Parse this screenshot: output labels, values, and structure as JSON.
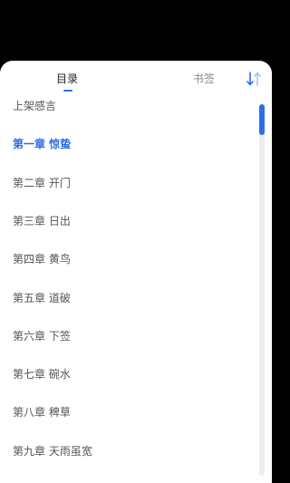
{
  "tabs": {
    "toc_label": "目录",
    "bookmarks_label": "书签"
  },
  "sort_icon": "sort-order-icon",
  "accent_color": "#2f6de4",
  "active_index": 1,
  "chapters": [
    "上架感言",
    "第一章 惊蛰",
    "第二章 开门",
    "第三章 日出",
    "第四章 黄鸟",
    "第五章 道破",
    "第六章 下签",
    "第七章 碗水",
    "第八章 稗草",
    "第九章 天雨虽宽"
  ]
}
